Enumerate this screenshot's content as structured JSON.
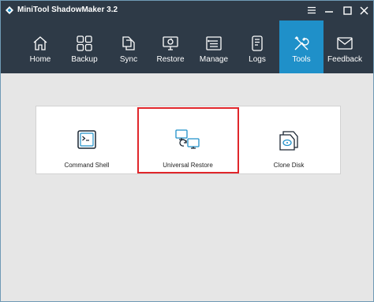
{
  "app": {
    "title": "MiniTool ShadowMaker 3.2"
  },
  "window_controls": [
    "menu-icon",
    "minimize-icon",
    "maximize-icon",
    "close-icon"
  ],
  "nav": {
    "items": [
      {
        "label": "Home",
        "icon": "home-icon"
      },
      {
        "label": "Backup",
        "icon": "backup-icon"
      },
      {
        "label": "Sync",
        "icon": "sync-icon"
      },
      {
        "label": "Restore",
        "icon": "restore-icon"
      },
      {
        "label": "Manage",
        "icon": "manage-icon"
      },
      {
        "label": "Logs",
        "icon": "logs-icon"
      },
      {
        "label": "Tools",
        "icon": "tools-icon",
        "active": true
      },
      {
        "label": "Feedback",
        "icon": "feedback-icon"
      }
    ]
  },
  "tools": {
    "cards": [
      {
        "label": "Command Shell",
        "icon": "command-shell-icon"
      },
      {
        "label": "Universal Restore",
        "icon": "universal-restore-icon",
        "highlighted": true
      },
      {
        "label": "Clone Disk",
        "icon": "clone-disk-icon"
      }
    ]
  },
  "colors": {
    "header": "#2e3a47",
    "accent": "#1f90c9",
    "highlight_border": "#e0262b",
    "content_bg": "#e6e6e6"
  }
}
